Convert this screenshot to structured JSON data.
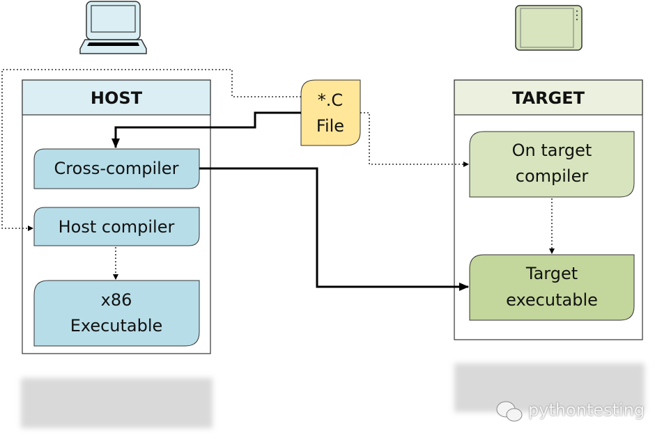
{
  "host": {
    "title": "HOST",
    "cross_compiler": "Cross-compiler",
    "host_compiler": "Host compiler",
    "x86_exec": [
      "x86",
      "Executable"
    ]
  },
  "target": {
    "title": "TARGET",
    "on_target_compiler": [
      "On target",
      "compiler"
    ],
    "target_exec": [
      "Target",
      "executable"
    ]
  },
  "source_file": [
    "*.C",
    "File"
  ],
  "watermark": "pythontesting",
  "colors": {
    "host_header": "#daeef3",
    "host_box": "#b7dde8",
    "target_header": "#ebf1de",
    "target_compiler": "#d7e4bd",
    "target_exec": "#c3d69b",
    "file": "#ffe699"
  },
  "icons": {
    "host": "laptop-icon",
    "target": "tablet-icon",
    "watermark": "wechat-icon"
  }
}
